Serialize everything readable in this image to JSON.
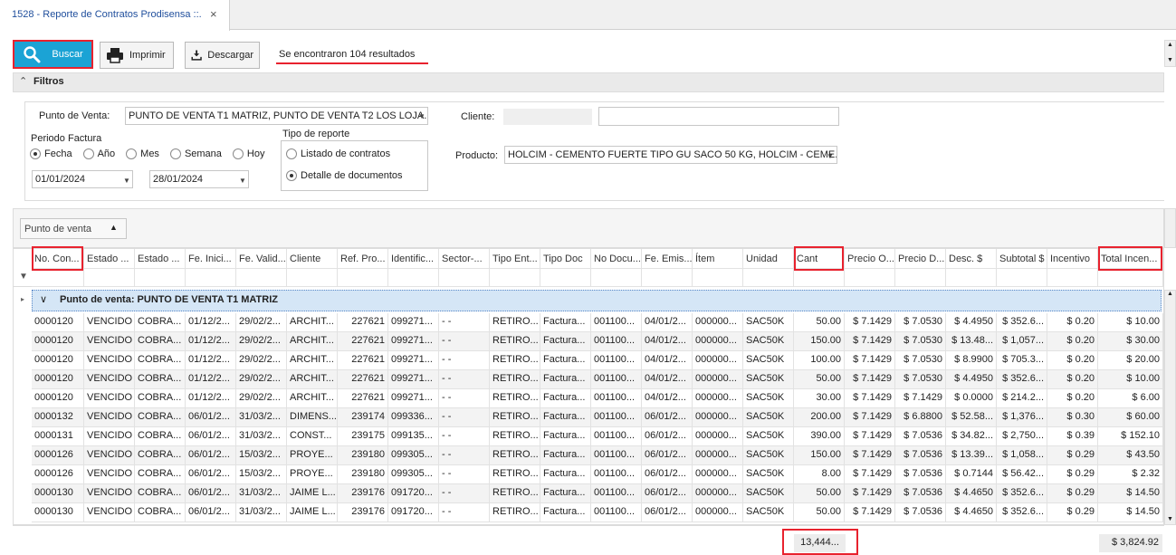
{
  "tab": {
    "title": "1528 - Reporte de Contratos Prodisensa ::.",
    "close": "×"
  },
  "toolbar": {
    "buscar": "Buscar",
    "imprimir": "Imprimir",
    "descargar": "Descargar",
    "result_text": "Se encontraron 104 resultados"
  },
  "filtros": {
    "title": "Filtros",
    "punto_venta_label": "Punto de Venta:",
    "punto_venta_value": "PUNTO DE VENTA T1 MATRIZ, PUNTO DE VENTA T2  LOS LOJA...",
    "periodo_label": "Periodo Factura",
    "periodo_options": [
      "Fecha",
      "Año",
      "Mes",
      "Semana",
      "Hoy"
    ],
    "periodo_selected": "Fecha",
    "date_from": "01/01/2024",
    "date_to": "28/01/2024",
    "tipo_reporte_label": "Tipo de reporte",
    "tipo_options": [
      "Listado de contratos",
      "Detalle de documentos"
    ],
    "tipo_selected": "Detalle de documentos",
    "cliente_label": "Cliente:",
    "cliente_value": "",
    "producto_label": "Producto:",
    "producto_value": "HOLCIM  - CEMENTO FUERTE TIPO GU SACO 50 KG, HOLCIM  - CEME..."
  },
  "grouping": {
    "chip": "Punto de venta"
  },
  "grid": {
    "columns": [
      "No. Con...",
      "Estado ...",
      "Estado ...",
      "Fe. Inici...",
      "Fe. Valid...",
      "Cliente",
      "Ref. Pro...",
      "Identific...",
      "Sector-...",
      "Tipo Ent...",
      "Tipo Doc",
      "No Docu...",
      "Fe. Emis...",
      "Ítem",
      "Unidad",
      "Cant",
      "Precio O...",
      "Precio D...",
      "Desc. $",
      "Subtotal $",
      "Incentivo",
      "Total Incen..."
    ],
    "group_label": "Punto de venta: PUNTO DE VENTA T1 MATRIZ",
    "rows": [
      [
        "0000120",
        "VENCIDO",
        "COBRA...",
        "01/12/2...",
        "29/02/2...",
        "ARCHIT...",
        "227621",
        "099271...",
        "- -",
        "RETIRO...",
        "Factura...",
        "001100...",
        "04/01/2...",
        "000000...",
        "SAC50K",
        "50.00",
        "$ 7.1429",
        "$ 7.0530",
        "$ 4.4950",
        "$ 352.6...",
        "$ 0.20",
        "$ 10.00"
      ],
      [
        "0000120",
        "VENCIDO",
        "COBRA...",
        "01/12/2...",
        "29/02/2...",
        "ARCHIT...",
        "227621",
        "099271...",
        "- -",
        "RETIRO...",
        "Factura...",
        "001100...",
        "04/01/2...",
        "000000...",
        "SAC50K",
        "150.00",
        "$ 7.1429",
        "$ 7.0530",
        "$ 13.48...",
        "$ 1,057...",
        "$ 0.20",
        "$ 30.00"
      ],
      [
        "0000120",
        "VENCIDO",
        "COBRA...",
        "01/12/2...",
        "29/02/2...",
        "ARCHIT...",
        "227621",
        "099271...",
        "- -",
        "RETIRO...",
        "Factura...",
        "001100...",
        "04/01/2...",
        "000000...",
        "SAC50K",
        "100.00",
        "$ 7.1429",
        "$ 7.0530",
        "$ 8.9900",
        "$ 705.3...",
        "$ 0.20",
        "$ 20.00"
      ],
      [
        "0000120",
        "VENCIDO",
        "COBRA...",
        "01/12/2...",
        "29/02/2...",
        "ARCHIT...",
        "227621",
        "099271...",
        "- -",
        "RETIRO...",
        "Factura...",
        "001100...",
        "04/01/2...",
        "000000...",
        "SAC50K",
        "50.00",
        "$ 7.1429",
        "$ 7.0530",
        "$ 4.4950",
        "$ 352.6...",
        "$ 0.20",
        "$ 10.00"
      ],
      [
        "0000120",
        "VENCIDO",
        "COBRA...",
        "01/12/2...",
        "29/02/2...",
        "ARCHIT...",
        "227621",
        "099271...",
        "- -",
        "RETIRO...",
        "Factura...",
        "001100...",
        "04/01/2...",
        "000000...",
        "SAC50K",
        "30.00",
        "$ 7.1429",
        "$ 7.1429",
        "$ 0.0000",
        "$ 214.2...",
        "$ 0.20",
        "$ 6.00"
      ],
      [
        "0000132",
        "VENCIDO",
        "COBRA...",
        "06/01/2...",
        "31/03/2...",
        "DIMENS...",
        "239174",
        "099336...",
        "- -",
        "RETIRO...",
        "Factura...",
        "001100...",
        "06/01/2...",
        "000000...",
        "SAC50K",
        "200.00",
        "$ 7.1429",
        "$ 6.8800",
        "$ 52.58...",
        "$ 1,376...",
        "$ 0.30",
        "$ 60.00"
      ],
      [
        "0000131",
        "VENCIDO",
        "COBRA...",
        "06/01/2...",
        "31/03/2...",
        "CONST...",
        "239175",
        "099135...",
        "- -",
        "RETIRO...",
        "Factura...",
        "001100...",
        "06/01/2...",
        "000000...",
        "SAC50K",
        "390.00",
        "$ 7.1429",
        "$ 7.0536",
        "$ 34.82...",
        "$ 2,750...",
        "$ 0.39",
        "$ 152.10"
      ],
      [
        "0000126",
        "VENCIDO",
        "COBRA...",
        "06/01/2...",
        "15/03/2...",
        "PROYE...",
        "239180",
        "099305...",
        "- -",
        "RETIRO...",
        "Factura...",
        "001100...",
        "06/01/2...",
        "000000...",
        "SAC50K",
        "150.00",
        "$ 7.1429",
        "$ 7.0536",
        "$ 13.39...",
        "$ 1,058...",
        "$ 0.29",
        "$ 43.50"
      ],
      [
        "0000126",
        "VENCIDO",
        "COBRA...",
        "06/01/2...",
        "15/03/2...",
        "PROYE...",
        "239180",
        "099305...",
        "- -",
        "RETIRO...",
        "Factura...",
        "001100...",
        "06/01/2...",
        "000000...",
        "SAC50K",
        "8.00",
        "$ 7.1429",
        "$ 7.0536",
        "$ 0.7144",
        "$ 56.42...",
        "$ 0.29",
        "$ 2.32"
      ],
      [
        "0000130",
        "VENCIDO",
        "COBRA...",
        "06/01/2...",
        "31/03/2...",
        "JAIME L...",
        "239176",
        "091720...",
        "- -",
        "RETIRO...",
        "Factura...",
        "001100...",
        "06/01/2...",
        "000000...",
        "SAC50K",
        "50.00",
        "$ 7.1429",
        "$ 7.0536",
        "$ 4.4650",
        "$ 352.6...",
        "$ 0.29",
        "$ 14.50"
      ],
      [
        "0000130",
        "VENCIDO",
        "COBRA...",
        "06/01/2...",
        "31/03/2...",
        "JAIME L...",
        "239176",
        "091720...",
        "- -",
        "RETIRO...",
        "Factura...",
        "001100...",
        "06/01/2...",
        "000000...",
        "SAC50K",
        "50.00",
        "$ 7.1429",
        "$ 7.0536",
        "$ 4.4650",
        "$ 352.6...",
        "$ 0.29",
        "$ 14.50"
      ]
    ],
    "summary": {
      "cant": "13,444...",
      "total_incentivo": "$ 3,824.92"
    }
  }
}
